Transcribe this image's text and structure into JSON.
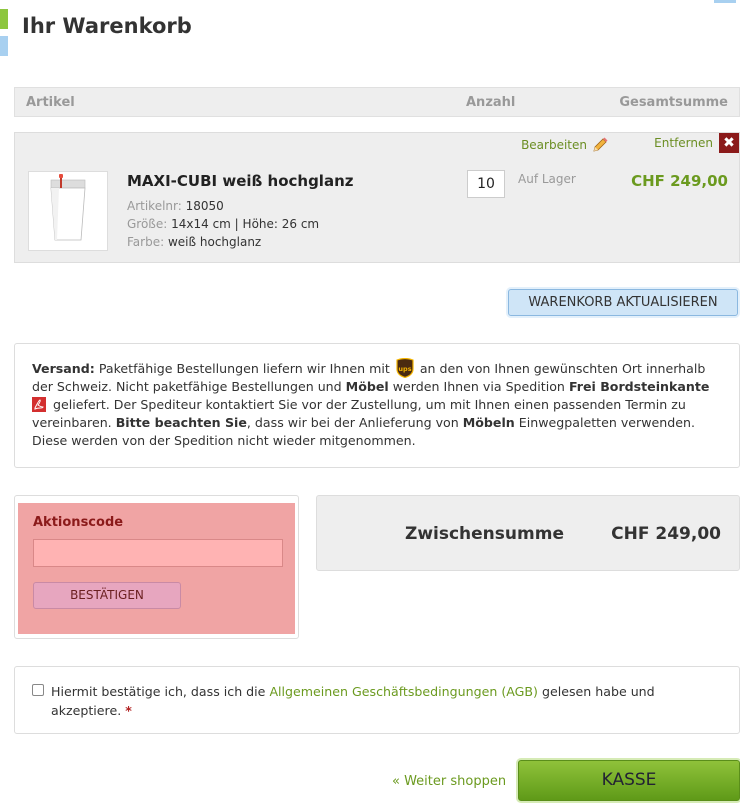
{
  "page": {
    "title": "Ihr Warenkorb"
  },
  "table_header": {
    "article": "Artikel",
    "quantity": "Anzahl",
    "total": "Gesamtsumme"
  },
  "cart_item": {
    "edit_label": "Bearbeiten",
    "remove_label": "Entfernen",
    "remove_glyph": "✖",
    "name": "MAXI-CUBI weiß hochglanz",
    "article_no_label": "Artikelnr:",
    "article_no": "18050",
    "size_label": "Größe:",
    "size": "14x14 cm | Höhe: 26 cm",
    "color_label": "Farbe:",
    "color": "weiß hochglanz",
    "quantity": "10",
    "stock": "Auf Lager",
    "line_total": "CHF 249,00"
  },
  "update_button": "WARENKORB AKTUALISIEREN",
  "shipping": {
    "label": "Versand:",
    "t1": "Paketfähige Bestellungen liefern wir Ihnen mit",
    "t2": "an den von Ihnen gewünschten Ort innerhalb der Schweiz. Nicht paketfähige Bestellungen und",
    "b1": "Möbel",
    "t3": "werden Ihnen via Spedition",
    "b2": "Frei Bordsteinkante",
    "t4": "geliefert. Der Spediteur kontaktiert Sie vor der Zustellung, um mit Ihnen einen passenden Termin zu vereinbaren.",
    "b3": "Bitte beachten Sie",
    "t5": ", dass wir bei der Anlieferung von",
    "b4": "Möbeln",
    "t6": "Einwegpaletten verwenden. Diese werden von der Spedition nicht wieder mitgenommen.",
    "ups_logo_text": "ups"
  },
  "promo": {
    "label": "Aktionscode",
    "input_value": "",
    "button": "BESTÄTIGEN"
  },
  "subtotal": {
    "label": "Zwischensumme",
    "value": "CHF 249,00"
  },
  "terms": {
    "t1": "Hiermit bestätige ich, dass ich die",
    "link": "Allgemeinen Geschäftsbedingungen (AGB)",
    "t2": "gelesen habe und akzeptiere.",
    "required": "*"
  },
  "footer": {
    "continue_link": "« Weiter shoppen",
    "checkout_button": "KASSE"
  },
  "colors": {
    "accent_green": "#6b9a1f",
    "remove_red": "#8b1a1a",
    "promo_bg": "#f0a4a4",
    "checkout_green": "#7ab22d",
    "update_blue": "#cfe5f7"
  }
}
